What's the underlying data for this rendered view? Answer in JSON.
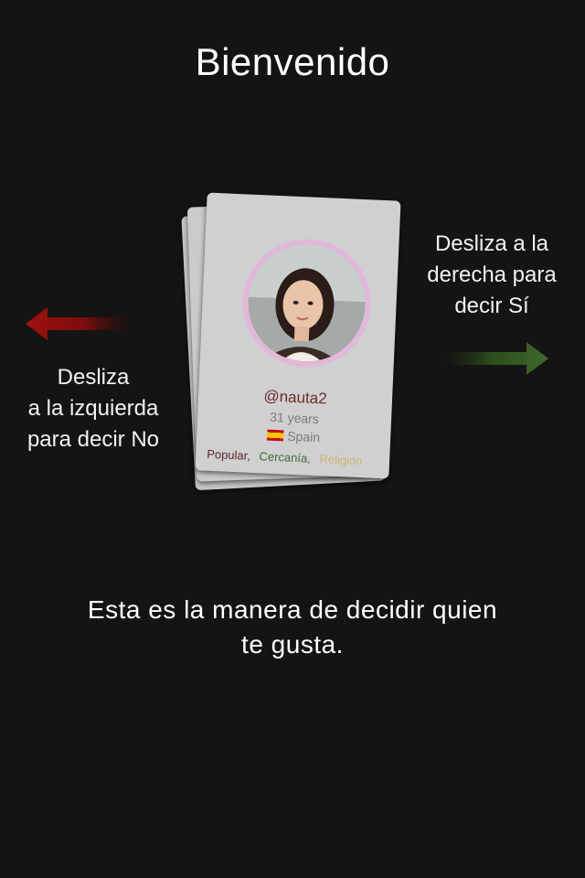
{
  "title": "Bienvenido",
  "hints": {
    "left": [
      "Desliza",
      "a la izquierda",
      "para decir No"
    ],
    "right": [
      "Desliza a la",
      "derecha para",
      "decir Sí"
    ]
  },
  "card": {
    "username": "@nauta2",
    "age": "31 years",
    "country": "Spain",
    "tags": [
      {
        "label": "Popular,",
        "color": "#5a2a2a"
      },
      {
        "label": "Cercanía,",
        "color": "#3f6a3f"
      },
      {
        "label": "Religion",
        "color": "#c8b67a"
      }
    ]
  },
  "footer": [
    "Esta es la manera de decidir quien",
    "te gusta."
  ],
  "colors": {
    "no_arrow": "#a0100f",
    "yes_arrow": "#3d6a2c",
    "background": "#141414"
  }
}
